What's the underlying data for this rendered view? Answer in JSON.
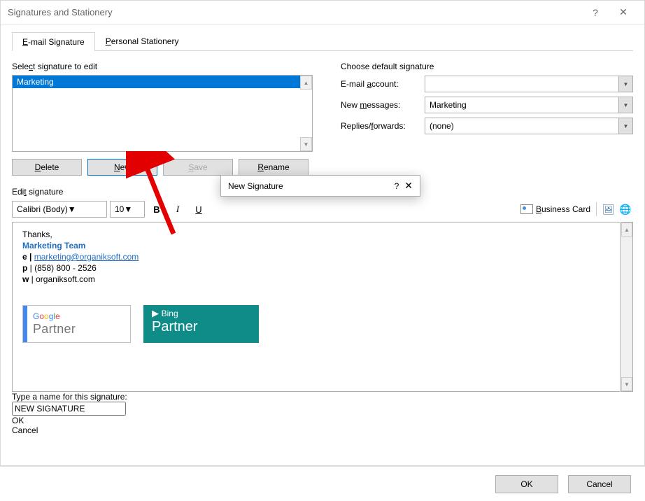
{
  "dialogTitle": "Signatures and Stationery",
  "tabs": {
    "email": "E-mail Signature",
    "stationery": "Personal Stationery"
  },
  "left": {
    "selectLabel": "Select signature to edit",
    "sigItems": [
      "Marketing"
    ],
    "buttons": {
      "delete": "Delete",
      "new": "New",
      "save": "Save",
      "rename": "Rename"
    }
  },
  "right": {
    "heading": "Choose default signature",
    "emailAccountLabel": "E-mail account:",
    "emailAccountValue": "",
    "newMessagesLabel": "New messages:",
    "newMessagesValue": "Marketing",
    "repliesLabel": "Replies/forwards:",
    "repliesValue": "(none)"
  },
  "editLabel": "Edit signature",
  "toolbar": {
    "font": "Calibri (Body)",
    "size": "10",
    "bizCard": "Business Card"
  },
  "signature": {
    "thanks": "Thanks,",
    "team": "Marketing Team",
    "e_prefix": "e | ",
    "email": "marketing@organiksoft.com",
    "p": "p | (858) 800 - 2526",
    "w": "w | organiksoft.com"
  },
  "badges": {
    "google": "Google",
    "partner": "Partner",
    "bing": "Bing"
  },
  "subDialog": {
    "title": "New Signature",
    "prompt": "Type a name for this signature:",
    "value": "NEW SIGNATURE",
    "ok": "OK",
    "cancel": "Cancel"
  },
  "footer": {
    "ok": "OK",
    "cancel": "Cancel"
  }
}
